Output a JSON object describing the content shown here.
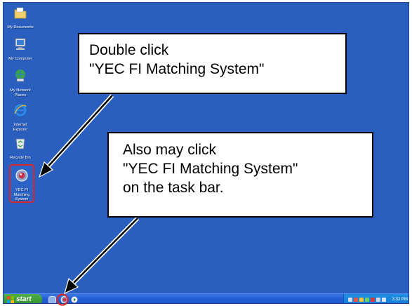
{
  "desktop": {
    "icons": [
      {
        "label": "My Documents",
        "icon": "folder-icon"
      },
      {
        "label": "My Computer",
        "icon": "computer-icon"
      },
      {
        "label": "My Network\nPlaces",
        "icon": "network-icon"
      },
      {
        "label": "Internet\nExplorer",
        "icon": "internet-explorer-icon"
      },
      {
        "label": "Recycle Bin",
        "icon": "recycle-bin-icon"
      },
      {
        "label": "YEC FI\nMatching\nSystem",
        "icon": "yec-fi-app-icon"
      }
    ]
  },
  "callouts": {
    "first": {
      "line1": "Double click",
      "line2": "\"YEC FI Matching System\""
    },
    "second": {
      "line1": "Also may click",
      "line2": "\"YEC FI Matching System\"",
      "line3": "on the task bar."
    }
  },
  "taskbar": {
    "start_label": "start",
    "clock": "3:32 PM",
    "quicklaunch": [
      "show-desktop-icon",
      "yec-fi-quicklaunch-icon",
      "media-player-icon"
    ]
  },
  "colors": {
    "desktop": "#2a5fbf",
    "highlight": "#d6282f",
    "taskbar": "#245ed8",
    "start": "#3a9a35"
  }
}
